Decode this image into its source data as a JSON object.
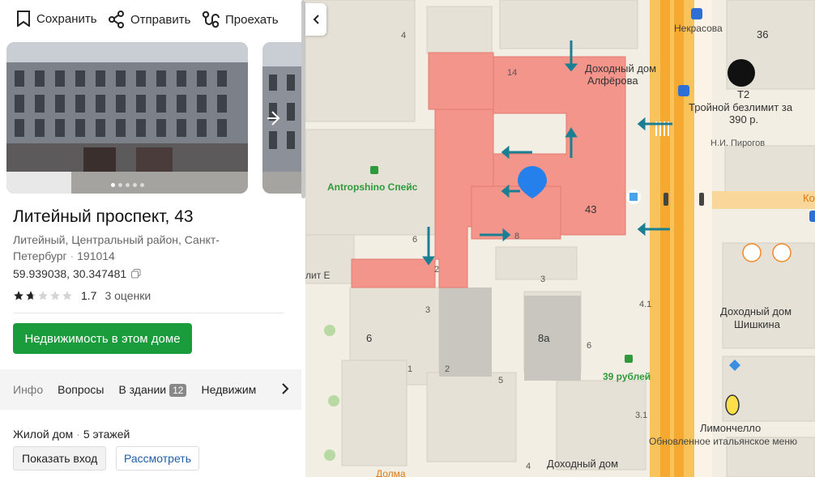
{
  "actions": {
    "save": "Сохранить",
    "share": "Отправить",
    "route": "Проехать"
  },
  "place": {
    "title": "Литейный проспект, 43",
    "address": "Литейный, Центральный район, Санкт-Петербург",
    "postcode": "191014",
    "coords": "59.939038, 30.347481",
    "rating_value": "1.7",
    "rating_count": "3 оценки",
    "rating_fraction": 0.34
  },
  "realty_button": "Недвижимость в этом доме",
  "tabs": [
    {
      "label": "Инфо"
    },
    {
      "label": "Вопросы"
    },
    {
      "label": "В здании",
      "badge": "12"
    },
    {
      "label": "Недвижим"
    }
  ],
  "info": {
    "type": "Жилой дом",
    "floors": "5 этажей",
    "show_entrance": "Показать вход",
    "view": "Рассмотреть"
  },
  "map": {
    "labels": {
      "nekrasova": "Некрасова",
      "num_36": "36",
      "num_4_top": "4",
      "dohodny_alferova_1": "Доходный дом",
      "dohodny_alferova_2": "Алфёрова",
      "num_14": "14",
      "t2_name": "T2",
      "t2_promo_1": "Тройной безлимит за",
      "t2_promo_2": "390 р.",
      "pirogov": "Н.И. Пирогов",
      "antropshino": "Antropshino Спейс",
      "num_43": "43",
      "ko": "Ко",
      "num_6a": "6",
      "num_8": "8",
      "lit_e": "лит Е",
      "num_2": "2",
      "num_3a": "3",
      "num_3b": "3",
      "num_41": "4.1",
      "dohodny_shishkina_1": "Доходный дом",
      "dohodny_shishkina_2": "Шишкина",
      "num_6b": "6",
      "num_8a": "8а",
      "num_6c": "6",
      "num_1": "1",
      "num_2b": "2",
      "num_5": "5",
      "rubley39": "39 рублей",
      "num_31": "3.1",
      "limoncello": "Лимончелло",
      "limoncello_desc": "Обновленное итальянское меню",
      "dolma": "Долма",
      "num_4_bottom": "4",
      "dohodny_bottom": "Доходный дом"
    }
  }
}
